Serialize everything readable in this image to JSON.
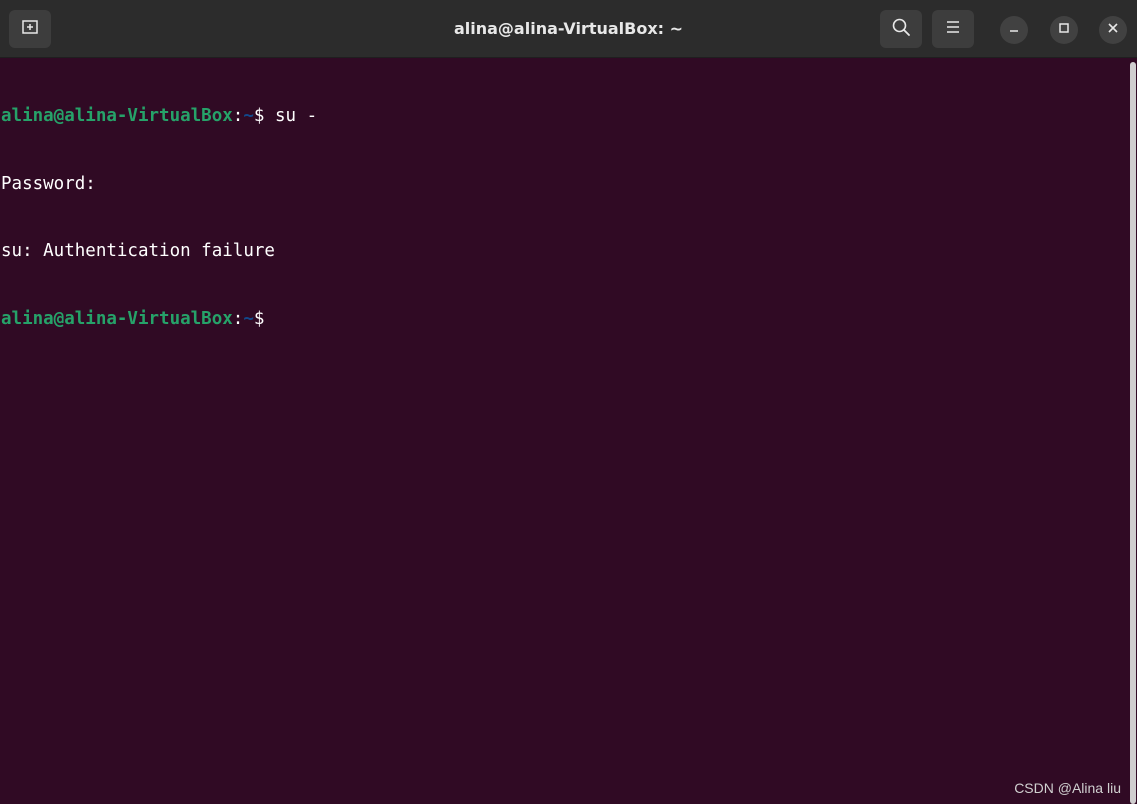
{
  "window": {
    "title": "alina@alina-VirtualBox: ~"
  },
  "header": {
    "new_tab_icon": "new-tab-icon",
    "search_icon": "search-icon",
    "menu_icon": "hamburger-menu-icon",
    "minimize_icon": "minimize-icon",
    "maximize_icon": "maximize-icon",
    "close_icon": "close-icon"
  },
  "terminal": {
    "lines": [
      {
        "user_host": "alina@alina-VirtualBox",
        "colon": ":",
        "path": "~",
        "dollar": "$",
        "command": " su -"
      },
      {
        "text": "Password:"
      },
      {
        "text": "su: Authentication failure"
      },
      {
        "user_host": "alina@alina-VirtualBox",
        "colon": ":",
        "path": "~",
        "dollar": "$",
        "command": " "
      }
    ]
  },
  "colors": {
    "background": "#300a24",
    "titlebar": "#2c2c2c",
    "prompt_user": "#26a269",
    "prompt_path": "#12488b",
    "text": "#ffffff"
  },
  "watermark": {
    "text": "CSDN @Alina liu"
  }
}
